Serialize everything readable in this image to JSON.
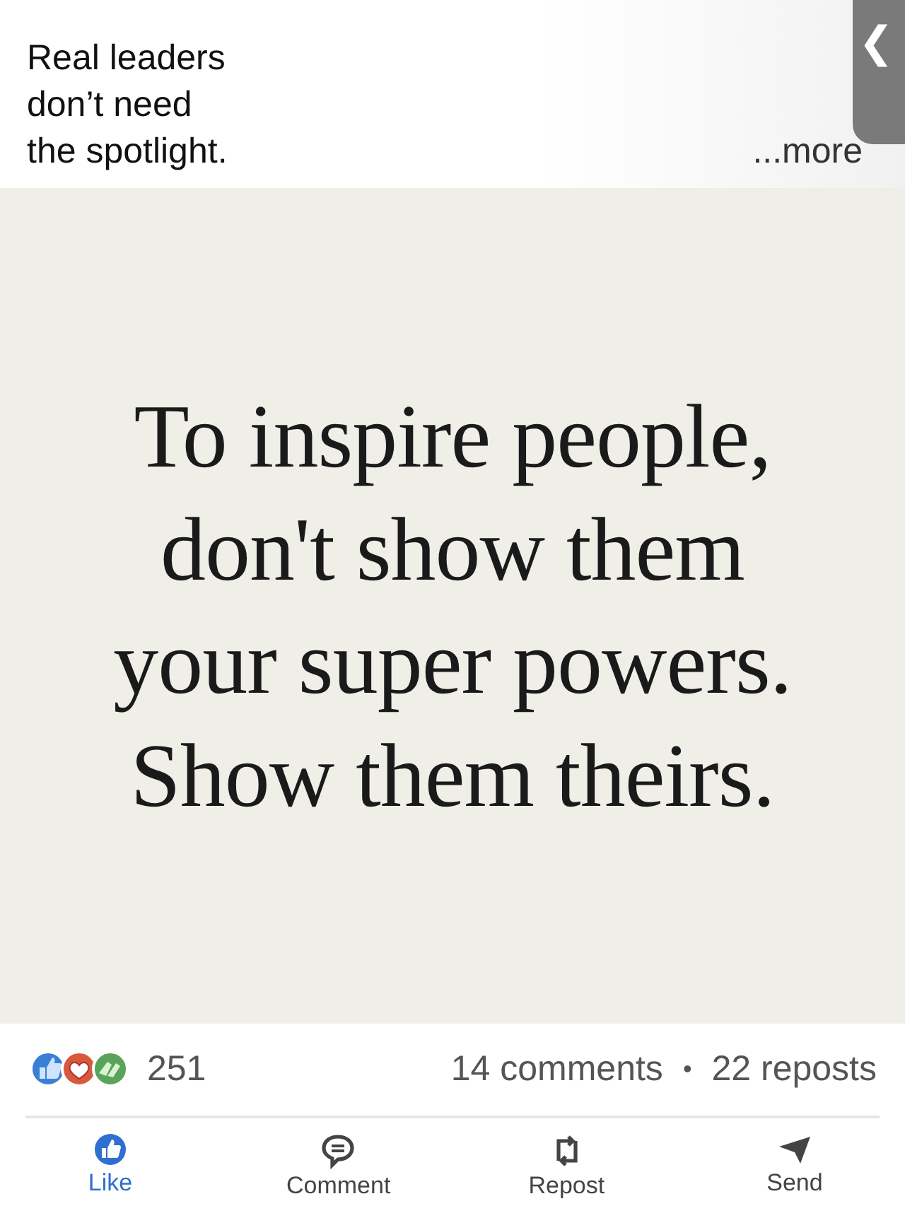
{
  "caption": {
    "lines": [
      "Real leaders",
      "don’t need",
      "the spotlight."
    ],
    "more_link": "...more"
  },
  "back_tab": {
    "icon": "❮"
  },
  "post_image": {
    "quote_lines": [
      "To inspire people,",
      "don't show them",
      "your super powers.",
      "Show them theirs."
    ]
  },
  "stats": {
    "reaction_count": "251",
    "comments": "14 comments",
    "separator": "•",
    "reposts": "22 reposts"
  },
  "actions": [
    {
      "kind": "like",
      "label": "Like",
      "selected": true
    },
    {
      "kind": "comment",
      "label": "Comment",
      "selected": false
    },
    {
      "kind": "repost",
      "label": "Repost",
      "selected": false
    },
    {
      "kind": "send",
      "label": "Send",
      "selected": false
    }
  ]
}
